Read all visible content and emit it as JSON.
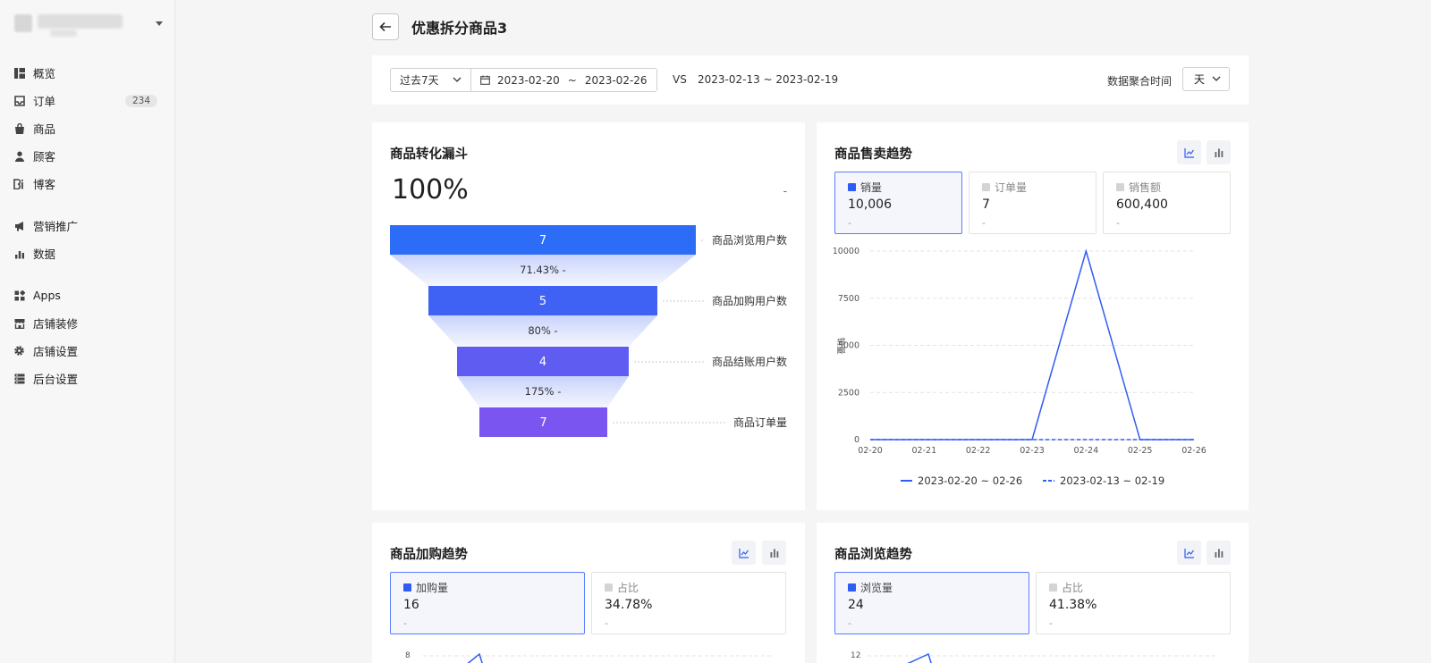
{
  "sidebar": {
    "items": [
      {
        "label": "概览",
        "icon": "overview-icon"
      },
      {
        "label": "订单",
        "icon": "inbox-icon",
        "badge": "234"
      },
      {
        "label": "商品",
        "icon": "bag-icon"
      },
      {
        "label": "顾客",
        "icon": "person-icon"
      },
      {
        "label": "博客",
        "icon": "blog-icon"
      },
      {
        "label": "营销推广",
        "icon": "megaphone-icon"
      },
      {
        "label": "数据",
        "icon": "bar-chart-icon"
      },
      {
        "label": "Apps",
        "icon": "apps-icon"
      },
      {
        "label": "店铺装修",
        "icon": "store-icon"
      },
      {
        "label": "店铺设置",
        "icon": "gear-icon"
      },
      {
        "label": "后台设置",
        "icon": "server-icon"
      }
    ]
  },
  "header": {
    "title": "优惠拆分商品3"
  },
  "filters": {
    "range": "过去7天",
    "date_start": "2023-02-20",
    "date_sep": "~",
    "date_end": "2023-02-26",
    "vs": "VS",
    "compare_range": "2023-02-13 ~ 2023-02-19",
    "agg_label": "数据聚合时间",
    "agg_value": "天"
  },
  "funnel_card": {
    "title": "商品转化漏斗",
    "overall": "100%",
    "overall_change": "-",
    "stages": [
      {
        "label": "商品浏览用户数",
        "value": "7",
        "color": "#2c6cf6"
      },
      {
        "label": "商品加购用户数",
        "value": "5",
        "color": "#3f62f5"
      },
      {
        "label": "商品结账用户数",
        "value": "4",
        "color": "#5f5cf1"
      },
      {
        "label": "商品订单量",
        "value": "7",
        "color": "#7b55f0"
      }
    ],
    "rates": [
      "71.43% -",
      "80% -",
      "175% -"
    ]
  },
  "sales_card": {
    "title": "商品售卖趋势",
    "metrics": [
      {
        "label": "销量",
        "value": "10,006",
        "sub": "-"
      },
      {
        "label": "订单量",
        "value": "7",
        "sub": "-"
      },
      {
        "label": "销售额",
        "value": "600,400",
        "sub": "-"
      }
    ],
    "legend": [
      "2023-02-20 ~ 02-26",
      "2023-02-13 ~ 02-19"
    ]
  },
  "cart_card": {
    "title": "商品加购趋势",
    "metrics": [
      {
        "label": "加购量",
        "value": "16",
        "sub": "-"
      },
      {
        "label": "占比",
        "value": "34.78%",
        "sub": "-"
      }
    ],
    "y_top": "8"
  },
  "views_card": {
    "title": "商品浏览趋势",
    "metrics": [
      {
        "label": "浏览量",
        "value": "24",
        "sub": "-"
      },
      {
        "label": "占比",
        "value": "41.38%",
        "sub": "-"
      }
    ],
    "y_top": "12"
  },
  "chart_data": {
    "type": "line",
    "categories": [
      "02-20",
      "02-21",
      "02-22",
      "02-23",
      "02-24",
      "02-25",
      "02-26"
    ],
    "ylabel": "销量",
    "ylim": [
      0,
      10000
    ],
    "yticks": [
      "10000",
      "7500",
      "5000",
      "2500",
      "0"
    ],
    "series": [
      {
        "name": "2023-02-20 ~ 02-26",
        "values": [
          0,
          0,
          0,
          0,
          10000,
          0,
          0
        ],
        "style": "solid",
        "color": "#2f5cf5"
      },
      {
        "name": "2023-02-13 ~ 02-19",
        "values": [
          0,
          0,
          0,
          0,
          0,
          0,
          0
        ],
        "style": "dashed",
        "color": "#2f5cf5"
      }
    ],
    "grid": true,
    "legend_position": "bottom"
  }
}
